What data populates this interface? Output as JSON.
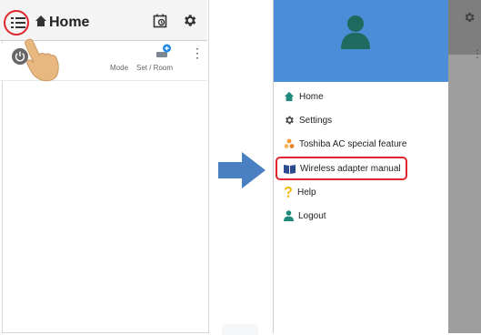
{
  "left_screen": {
    "header_title": "Home",
    "device_row": {
      "mode_label": "Mode",
      "setroom_label": "Set / Room",
      "kebab": "⋮"
    }
  },
  "right_screen": {
    "drawer_items": [
      {
        "label": "Home",
        "icon": "home-icon"
      },
      {
        "label": "Settings",
        "icon": "gear-icon"
      },
      {
        "label": "Toshiba AC special feature",
        "icon": "special-feature-icon"
      },
      {
        "label": "Wireless adapter manual",
        "icon": "book-icon"
      },
      {
        "label": "Help",
        "icon": "question-icon"
      },
      {
        "label": "Logout",
        "icon": "person-icon"
      }
    ],
    "highlighted_item": "Wireless adapter manual",
    "dim_kebab": "⋮"
  },
  "colors": {
    "accent_red": "#e0262e",
    "drawer_header_blue": "#4a8ed8",
    "arrow_blue": "#4a7fc1",
    "home_teal": "#1f8a7c",
    "book_blue": "#2a4c8e",
    "help_yellow": "#f2b705",
    "feature_orange": "#f39c34"
  }
}
